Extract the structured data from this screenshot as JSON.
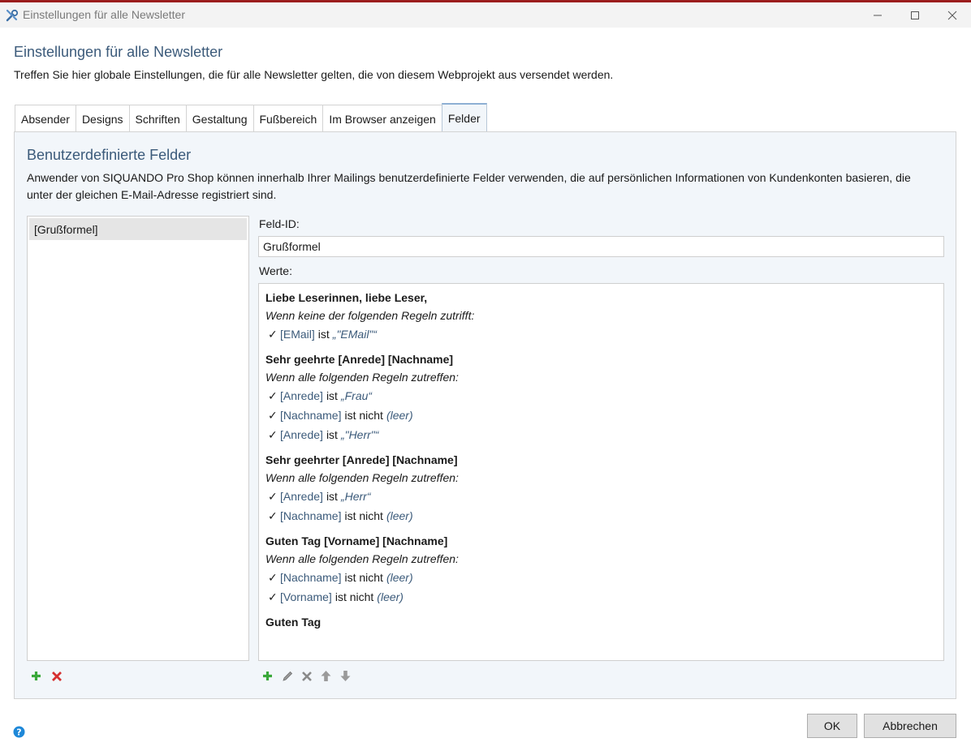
{
  "window": {
    "title": "Einstellungen für alle Newsletter"
  },
  "header": {
    "title": "Einstellungen für alle Newsletter",
    "subtitle": "Treffen Sie hier globale Einstellungen, die für alle Newsletter gelten, die von diesem Webprojekt aus versendet werden."
  },
  "tabs": [
    {
      "label": "Absender",
      "active": false
    },
    {
      "label": "Designs",
      "active": false
    },
    {
      "label": "Schriften",
      "active": false
    },
    {
      "label": "Gestaltung",
      "active": false
    },
    {
      "label": "Fußbereich",
      "active": false
    },
    {
      "label": "Im Browser anzeigen",
      "active": false
    },
    {
      "label": "Felder",
      "active": true
    }
  ],
  "panel": {
    "title": "Benutzerdefinierte Felder",
    "description": "Anwender von SIQUANDO Pro Shop können innerhalb Ihrer Mailings benutzerdefinierte Felder verwenden, die auf persönlichen Informationen von Kundenkonten basieren, die unter der gleichen E-Mail-Adresse registriert sind."
  },
  "field_list": {
    "items": [
      "[Grußformel]"
    ],
    "selected_index": 0
  },
  "field_id": {
    "label": "Feld-ID:",
    "value": "Grußformel"
  },
  "values": {
    "label": "Werte:",
    "groups": [
      {
        "title": "Liebe Leserinnen, liebe Leser,",
        "condition": "Wenn keine der folgenden Regeln zutrifft:",
        "rules": [
          {
            "field": "[EMail]",
            "op": "ist",
            "value": "„\"EMail\"“"
          }
        ]
      },
      {
        "title": "Sehr geehrte [Anrede] [Nachname]",
        "condition": "Wenn alle folgenden Regeln zutreffen:",
        "rules": [
          {
            "field": "[Anrede]",
            "op": "ist",
            "value": "„Frau“"
          },
          {
            "field": "[Nachname]",
            "op": "ist nicht",
            "value": "(leer)"
          },
          {
            "field": "[Anrede]",
            "op": "ist",
            "value": "„\"Herr\"“"
          }
        ]
      },
      {
        "title": "Sehr geehrter [Anrede] [Nachname]",
        "condition": "Wenn alle folgenden Regeln zutreffen:",
        "rules": [
          {
            "field": "[Anrede]",
            "op": "ist",
            "value": "„Herr“"
          },
          {
            "field": "[Nachname]",
            "op": "ist nicht",
            "value": "(leer)"
          }
        ]
      },
      {
        "title": "Guten Tag [Vorname] [Nachname]",
        "condition": "Wenn alle folgenden Regeln zutreffen:",
        "rules": [
          {
            "field": "[Nachname]",
            "op": "ist nicht",
            "value": "(leer)"
          },
          {
            "field": "[Vorname]",
            "op": "ist nicht",
            "value": "(leer)"
          }
        ]
      },
      {
        "title": "Guten Tag",
        "condition": "",
        "rules": []
      }
    ]
  },
  "buttons": {
    "ok": "OK",
    "cancel": "Abbrechen"
  },
  "colors": {
    "accent_text": "#3b5a7a",
    "panel_bg": "#f2f6fa",
    "add_green": "#3aa83a",
    "delete_red": "#d63030",
    "help_blue": "#1e88d8"
  }
}
